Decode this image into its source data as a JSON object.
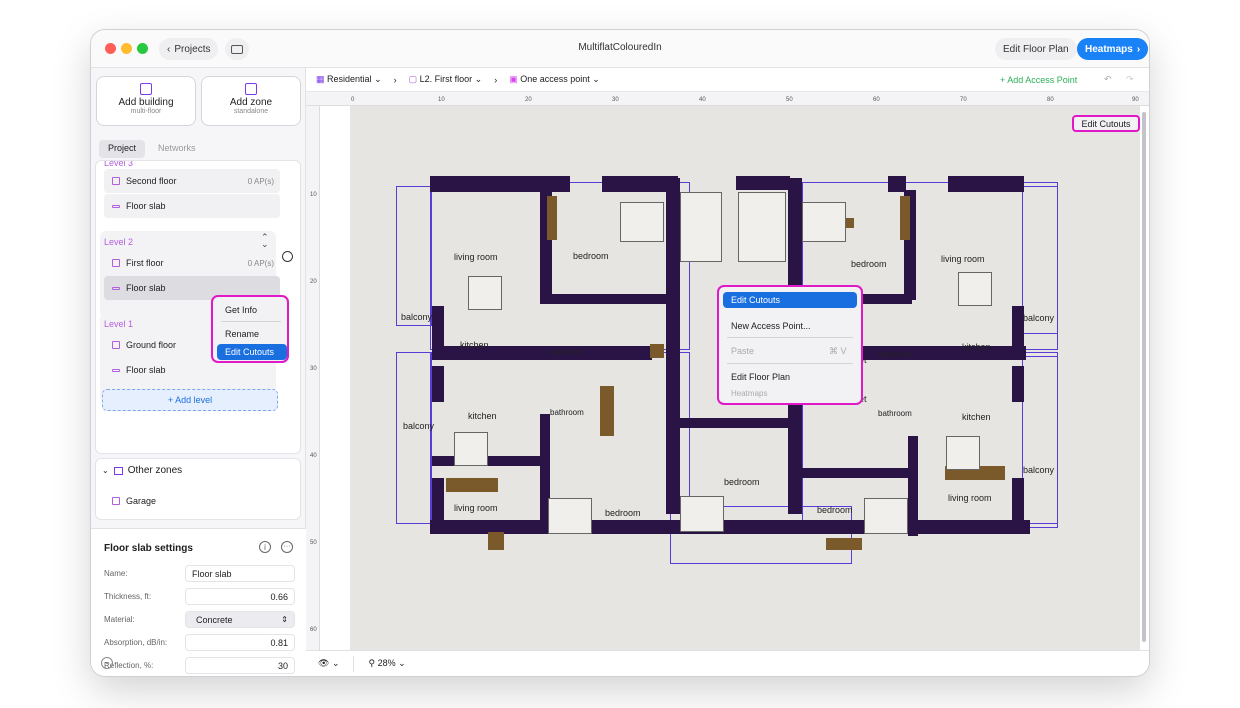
{
  "window": {
    "title": "MultiflatColouredIn",
    "back_label": "Projects",
    "edit_floor_plan": "Edit Floor Plan",
    "heatmaps": "Heatmaps"
  },
  "sidebar": {
    "add_building": {
      "label": "Add building",
      "sub": "multi-floor"
    },
    "add_zone": {
      "label": "Add zone",
      "sub": "standalone"
    },
    "tabs": [
      "Project",
      "Networks"
    ],
    "level3": {
      "header": "Level 3",
      "items": [
        {
          "name": "Second floor",
          "aps": "0 AP(s)"
        },
        {
          "name": "Floor slab"
        }
      ]
    },
    "level2": {
      "header": "Level 2",
      "items": [
        {
          "name": "First floor",
          "aps": "0 AP(s)"
        },
        {
          "name": "Floor slab"
        }
      ]
    },
    "level1": {
      "header": "Level 1",
      "items": [
        {
          "name": "Ground floor"
        },
        {
          "name": "Floor slab"
        }
      ]
    },
    "add_level": "+ Add level",
    "other_zones": "Other zones",
    "garage": "Garage"
  },
  "sidebar_menu": {
    "items": [
      "Get Info",
      "Rename",
      "Edit Cutouts"
    ]
  },
  "settings": {
    "title": "Floor slab settings",
    "fields": [
      {
        "label": "Name:",
        "value": "Floor slab"
      },
      {
        "label": "Thickness, ft:",
        "value": "0.66"
      },
      {
        "label": "Material:",
        "value": "Concrete"
      },
      {
        "label": "Absorption, dB/in:",
        "value": "0.81"
      },
      {
        "label": "Reflection, %:",
        "value": "30"
      }
    ]
  },
  "breadcrumb": {
    "building": "Residential",
    "floor": "L2. First floor",
    "ap": "One access point"
  },
  "add_access_point": "+ Add Access Point",
  "ruler": {
    "h_ticks": [
      "0",
      "10",
      "20",
      "30",
      "40",
      "50",
      "60",
      "70",
      "80",
      "90"
    ],
    "v_ticks": [
      "10",
      "20",
      "30",
      "40",
      "50",
      "60"
    ]
  },
  "canvas_button": "Edit Cutouts",
  "context_menu": {
    "items": [
      "Edit Cutouts",
      "New Access Point...",
      "Paste",
      "⌘ V",
      "Edit Floor Plan",
      "Heatmaps"
    ]
  },
  "rooms": [
    "living room",
    "bedroom",
    "bedroom",
    "living room",
    "balcony",
    "kitchen",
    "bathroom",
    "bathroom",
    "kitchen",
    "balcony",
    "kitchen",
    "bathroom",
    "bathroom",
    "kitchen",
    "balcony",
    "living room",
    "bedroom",
    "bedroom",
    "bedroom",
    "balcony",
    "living room",
    "et",
    "et"
  ],
  "zoom": "28%"
}
